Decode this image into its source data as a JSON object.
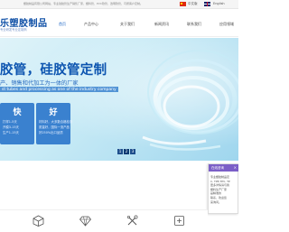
{
  "topbar": {
    "notice": "塑胶制品有限公司网站，专业硅胶管生产销售厂家，塑料管、PVC软管、透明软管，可按客户定制。",
    "lang_cn": "中文版",
    "lang_en": "English"
  },
  "header": {
    "logo_title": "乐塑胶制品",
    "logo_sub": "专业研发专业定制商",
    "nav": [
      "首页",
      "产品中心",
      "关于我们",
      "新闻资讯",
      "联系我们",
      "应用领域"
    ]
  },
  "banner": {
    "headline": "胶管，硅胶管定制",
    "subline": "产、销售和代加工为一体的厂家",
    "enline": "st tubes and processing as one of the industry company",
    "cards": [
      {
        "big": "快",
        "lines": [
          "打样1-5天",
          "开模3-15天",
          "生产1-15天"
        ]
      },
      {
        "big": "好",
        "lines": [
          "材料好，大多数合格检测",
          "质量好，国际一流产品",
          "好250%出口品质"
        ]
      }
    ],
    "dots": [
      "1",
      "2",
      "3"
    ]
  },
  "chat": {
    "title": "在线咨询",
    "close": "×",
    "lines": [
      "专业塑胶制品定",
      "C, TPE,TPV, TP",
      "更多详情请与我",
      "塑料生产厂家",
      "是精准的",
      "联系，欢迎您",
      "来询问。"
    ]
  },
  "bottom_icons": [
    "box-icon",
    "diamond-icon",
    "tools-icon",
    "export-icon"
  ]
}
